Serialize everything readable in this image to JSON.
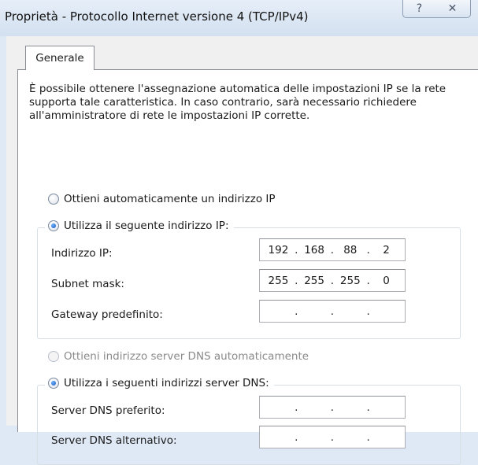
{
  "window": {
    "title": "Proprietà - Protocollo Internet versione 4 (TCP/IPv4)",
    "help_glyph": "?",
    "close_glyph": "✕"
  },
  "tabs": [
    {
      "label": "Generale",
      "active": true
    }
  ],
  "description": "È possibile ottenere l'assegnazione automatica delle impostazioni IP se la rete supporta tale caratteristica. In caso contrario, sarà necessario richiedere all'amministratore di rete le impostazioni IP corrette.",
  "ip_section": {
    "auto_option": {
      "label": "Ottieni automaticamente un indirizzo IP",
      "checked": false
    },
    "manual_option": {
      "label": "Utilizza il seguente indirizzo IP:",
      "checked": true
    },
    "fields": [
      {
        "label": "Indirizzo IP:",
        "octets": [
          "192",
          "168",
          "88",
          "2"
        ]
      },
      {
        "label": "Subnet mask:",
        "octets": [
          "255",
          "255",
          "255",
          "0"
        ]
      },
      {
        "label": "Gateway predefinito:",
        "octets": [
          "",
          "",
          "",
          ""
        ]
      }
    ]
  },
  "dns_section": {
    "auto_option": {
      "label": "Ottieni indirizzo server DNS automaticamente",
      "checked": false,
      "disabled": true
    },
    "manual_option": {
      "label": "Utilizza i seguenti indirizzi server DNS:",
      "checked": true
    },
    "fields": [
      {
        "label": "Server DNS preferito:",
        "octets": [
          "",
          "",
          "",
          ""
        ]
      },
      {
        "label": "Server DNS alternativo:",
        "octets": [
          "",
          "",
          "",
          ""
        ]
      }
    ]
  },
  "dot_char": "."
}
